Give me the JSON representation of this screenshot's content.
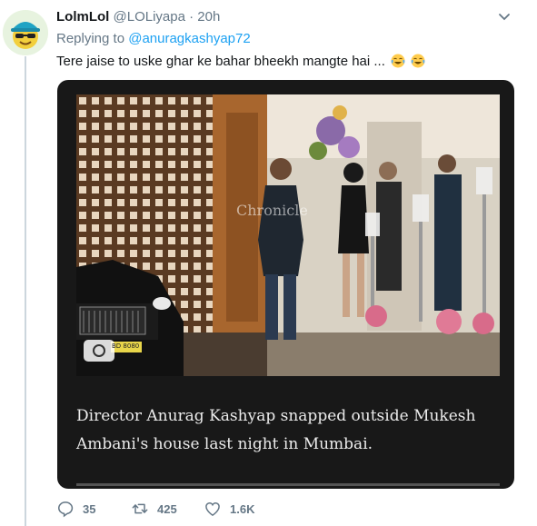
{
  "tweet": {
    "display_name": "LolmLol",
    "handle": "@LOLiyapa",
    "separator": "·",
    "time": "20h",
    "replying_prefix": "Replying to",
    "replying_to": "@anuragkashyap72",
    "text": "Tere jaise to uske ghar ke bahar bheekh mangte hai ...",
    "emojis": [
      "face-with-tears-of-joy-icon",
      "face-with-tears-of-joy-icon"
    ]
  },
  "media": {
    "watermark": "Chronicle",
    "plate_text": "BD 8080",
    "caption": "Director Anurag Kashyap snapped outside Mukesh Ambani's house last night in Mumbai."
  },
  "actions": {
    "replies": "35",
    "retweets": "425",
    "likes": "1.6K"
  },
  "colors": {
    "link": "#1da1f2",
    "muted": "#657786",
    "card_bg": "#181818"
  }
}
